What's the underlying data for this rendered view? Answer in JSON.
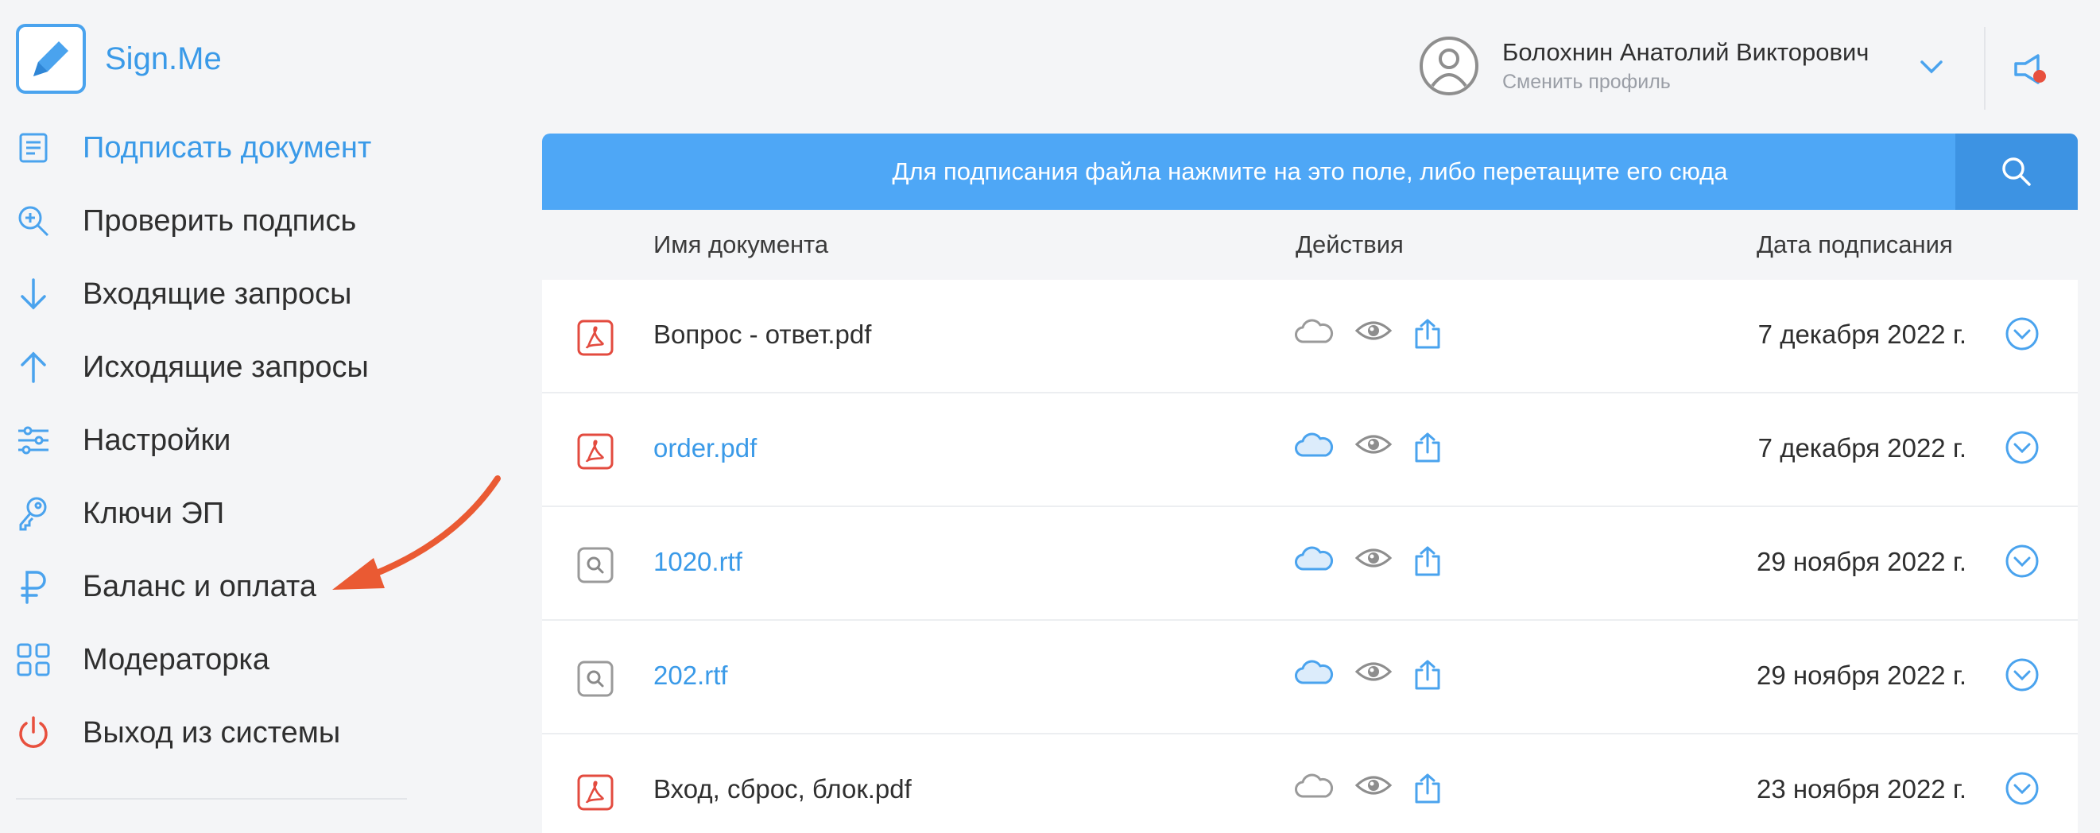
{
  "brand": {
    "name": "Sign.Me"
  },
  "colors": {
    "accent": "#3a9ae8",
    "banner": "#4ea7f6",
    "pdf_red": "#e34b3f",
    "arrow": "#ea5a33",
    "logout": "#e8503e"
  },
  "nav": {
    "items": [
      {
        "label": "Подписать документ",
        "icon": "document-icon",
        "active": true
      },
      {
        "label": "Проверить подпись",
        "icon": "zoom-in-icon"
      },
      {
        "label": "Входящие запросы",
        "icon": "arrow-down-icon"
      },
      {
        "label": "Исходящие запросы",
        "icon": "arrow-up-icon"
      },
      {
        "label": "Настройки",
        "icon": "sliders-icon"
      },
      {
        "label": "Ключи ЭП",
        "icon": "key-icon"
      },
      {
        "label": "Баланс и оплата",
        "icon": "ruble-icon"
      },
      {
        "label": "Модераторка",
        "icon": "grid-icon"
      },
      {
        "label": "Выход из системы",
        "icon": "power-icon"
      }
    ]
  },
  "profile": {
    "name": "Болохнин Анатолий Викторович",
    "subtitle": "Сменить профиль"
  },
  "dropzone": {
    "text": "Для подписания файла нажмите на это поле, либо перетащите его сюда"
  },
  "table": {
    "headers": {
      "name": "Имя документа",
      "actions": "Действия",
      "date": "Дата подписания"
    },
    "rows": [
      {
        "name": "Вопрос - ответ.pdf",
        "type": "pdf",
        "date": "7 декабря 2022 г.",
        "cloud_active": false,
        "link": false
      },
      {
        "name": "order.pdf",
        "type": "pdf",
        "date": "7 декабря 2022 г.",
        "cloud_active": true,
        "link": true
      },
      {
        "name": "1020.rtf",
        "type": "rtf",
        "date": "29 ноября 2022 г.",
        "cloud_active": true,
        "link": true
      },
      {
        "name": "202.rtf",
        "type": "rtf",
        "date": "29 ноября 2022 г.",
        "cloud_active": true,
        "link": true
      },
      {
        "name": "Вход, сброс, блок.pdf",
        "type": "pdf",
        "date": "23 ноября 2022 г.",
        "cloud_active": false,
        "link": false
      }
    ]
  }
}
